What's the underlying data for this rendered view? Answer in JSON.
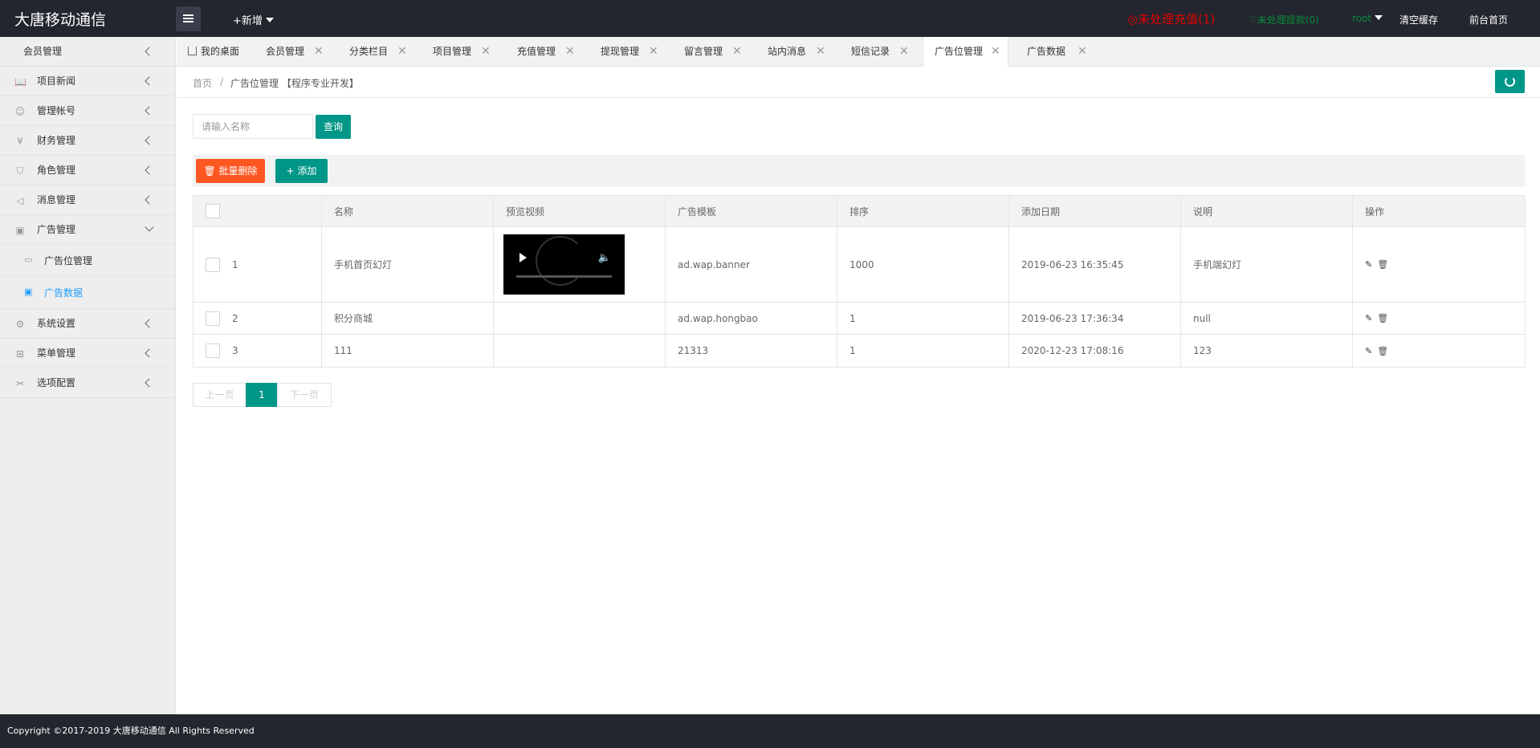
{
  "header": {
    "logo": "大唐移动通信",
    "add_new": "+新增",
    "recharge_alert": "◎未处理充值(1)",
    "withdraw_alert": "♡未处理提款(0)",
    "user": "root",
    "clear_cache": "清空缓存",
    "front_home": "前台首页"
  },
  "sidebar": {
    "items": [
      {
        "label": "会员管理",
        "icon": "none"
      },
      {
        "label": "项目新闻",
        "icon": "book-icon"
      },
      {
        "label": "管理帐号",
        "icon": "user-icon"
      },
      {
        "label": "财务管理",
        "icon": "yen-icon"
      },
      {
        "label": "角色管理",
        "icon": "shield-icon"
      },
      {
        "label": "消息管理",
        "icon": "speaker-icon"
      },
      {
        "label": "广告管理",
        "icon": "image-icon"
      },
      {
        "label": "系统设置",
        "icon": "gear-icon"
      },
      {
        "label": "菜单管理",
        "icon": "grid-icon"
      },
      {
        "label": "选项配置",
        "icon": "tools-icon"
      }
    ],
    "sub_items": [
      {
        "label": "广告位管理",
        "icon": "card-icon"
      },
      {
        "label": "广告数据",
        "icon": "image-icon"
      }
    ]
  },
  "tabs": [
    {
      "label": "我的桌面"
    },
    {
      "label": "会员管理"
    },
    {
      "label": "分类栏目"
    },
    {
      "label": "项目管理"
    },
    {
      "label": "充值管理"
    },
    {
      "label": "提现管理"
    },
    {
      "label": "留言管理"
    },
    {
      "label": "站内消息"
    },
    {
      "label": "短信记录"
    },
    {
      "label": "广告位管理"
    },
    {
      "label": "广告数据"
    }
  ],
  "tab_close": "✕",
  "breadcrumb": {
    "home": "首页",
    "sep": "/",
    "current": "广告位管理 【程序专业开发】"
  },
  "search": {
    "placeholder": "请输入名称",
    "button": "查询"
  },
  "toolbar": {
    "batch_delete": "批量删除",
    "add": "添加"
  },
  "table": {
    "columns": [
      "",
      "名称",
      "预览视频",
      "广告模板",
      "排序",
      "添加日期",
      "说明",
      "操作"
    ],
    "rows": [
      {
        "id": "1",
        "name": "手机首页幻灯",
        "video": true,
        "template": "ad.wap.banner",
        "sort": "1000",
        "date": "2019-06-23 16:35:45",
        "desc": "手机端幻灯"
      },
      {
        "id": "2",
        "name": "积分商城",
        "video": false,
        "template": "ad.wap.hongbao",
        "sort": "1",
        "date": "2019-06-23 17:36:34",
        "desc": "null"
      },
      {
        "id": "3",
        "name": "111",
        "video": false,
        "template": "21313",
        "sort": "1",
        "date": "2020-12-23 17:08:16",
        "desc": "123"
      }
    ]
  },
  "pager": {
    "prev": "上一页",
    "current": "1",
    "next": "下一页"
  },
  "footer": "Copyright ©2017-2019 大唐移动通信 All Rights Reserved",
  "colors": {
    "header_bg": "#23262e",
    "primary": "#009688",
    "danger": "#ff5722",
    "alert_red": "#e00000",
    "alert_green": "#0a8a3c"
  }
}
